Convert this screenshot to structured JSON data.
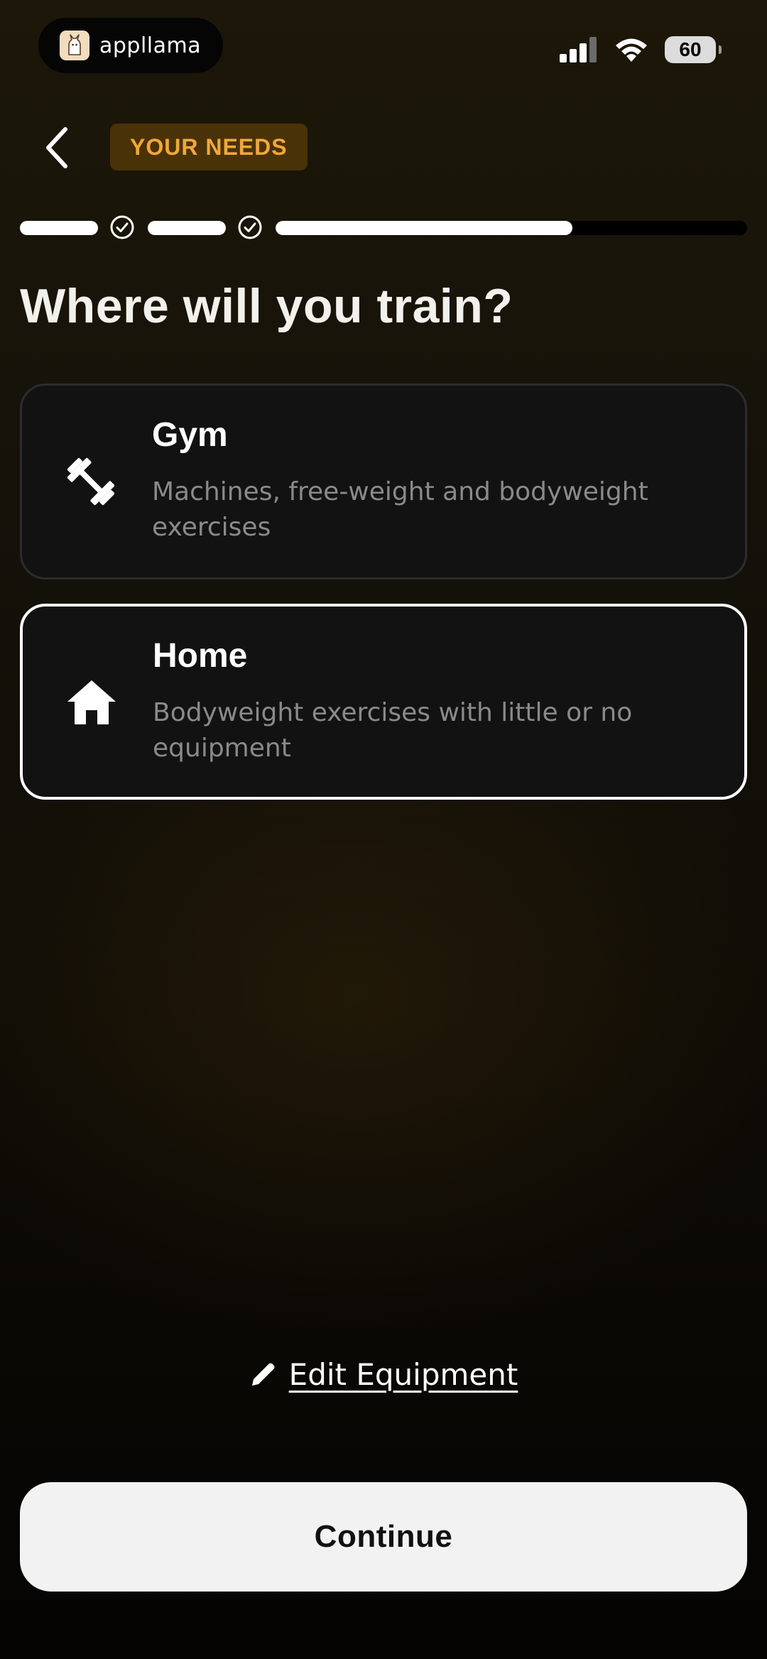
{
  "status_bar": {
    "app_name": "appllama",
    "battery_level": "60",
    "icons": [
      "cellular-signal-icon",
      "wifi-icon",
      "battery-icon"
    ]
  },
  "header": {
    "section_label": "YOUR NEEDS",
    "back_icon": "chevron-left-icon"
  },
  "progress": {
    "completed_steps": 2,
    "current_step_fill": 0.63
  },
  "page": {
    "title": "Where will you train?"
  },
  "options": [
    {
      "title": "Gym",
      "description": "Machines, free-weight and bodyweight exercises",
      "icon": "dumbbell-icon",
      "selected": false
    },
    {
      "title": "Home",
      "description": "Bodyweight exercises with little or no equipment",
      "icon": "house-icon",
      "selected": true
    }
  ],
  "edit_equipment": {
    "label": "Edit Equipment",
    "icon": "pencil-icon"
  },
  "continue_button": {
    "label": "Continue"
  },
  "colors": {
    "badge_bg": "#4a3208",
    "badge_text": "#f0a83a",
    "card_bg": "#121212",
    "selected_border": "#ffffff",
    "button_bg": "#f2f2f2"
  }
}
